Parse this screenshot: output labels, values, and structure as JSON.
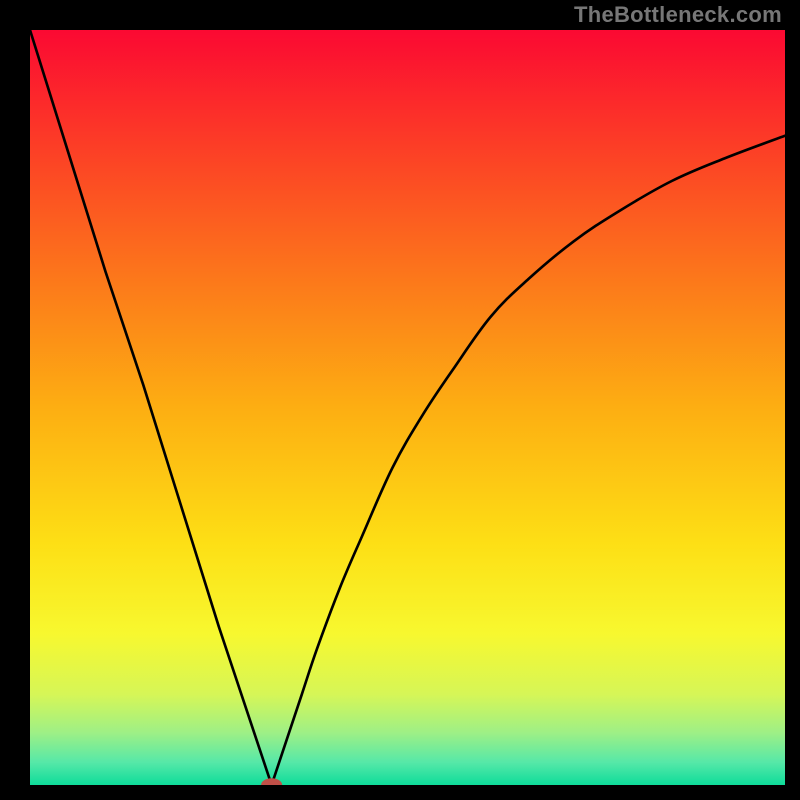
{
  "watermark": "TheBottleneck.com",
  "colors": {
    "frame": "#000000",
    "curve": "#000000",
    "marker_fill": "#c05048",
    "gradient_stops": [
      {
        "offset": 0.0,
        "color": "#fb0932"
      },
      {
        "offset": 0.17,
        "color": "#fc4325"
      },
      {
        "offset": 0.34,
        "color": "#fc7b1a"
      },
      {
        "offset": 0.5,
        "color": "#fdae12"
      },
      {
        "offset": 0.68,
        "color": "#fddf15"
      },
      {
        "offset": 0.8,
        "color": "#f7f82f"
      },
      {
        "offset": 0.88,
        "color": "#d6f657"
      },
      {
        "offset": 0.93,
        "color": "#9ff085"
      },
      {
        "offset": 0.97,
        "color": "#56e8a8"
      },
      {
        "offset": 1.0,
        "color": "#0edc9a"
      }
    ]
  },
  "chart_data": {
    "type": "line",
    "title": "",
    "xlabel": "",
    "ylabel": "",
    "xlim": [
      0,
      100
    ],
    "ylim": [
      0,
      100
    ],
    "grid": false,
    "series": [
      {
        "name": "left-branch",
        "x": [
          0,
          5,
          10,
          15,
          20,
          25,
          30,
          32
        ],
        "values": [
          100,
          84,
          68,
          53,
          37,
          21,
          6,
          0
        ]
      },
      {
        "name": "right-branch",
        "x": [
          32,
          34,
          36,
          38,
          41,
          44,
          48,
          52,
          56,
          61,
          66,
          72,
          78,
          85,
          92,
          100
        ],
        "values": [
          0,
          6,
          12,
          18,
          26,
          33,
          42,
          49,
          55,
          62,
          67,
          72,
          76,
          80,
          83,
          86
        ]
      }
    ],
    "marker": {
      "x": 32,
      "y": 0,
      "rx": 1.4,
      "ry": 0.9
    }
  }
}
